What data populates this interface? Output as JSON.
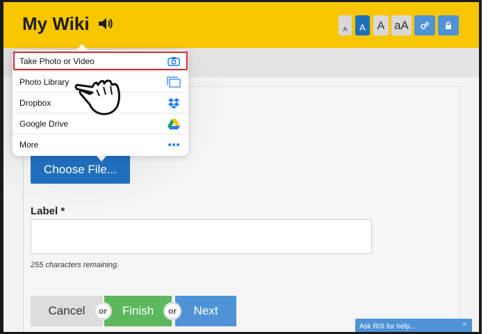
{
  "header": {
    "title": "My Wiki",
    "text_size_buttons": [
      "A",
      "A",
      "A",
      "aA"
    ],
    "speaker_icon": "speaker-icon",
    "settings_icon": "settings-icon",
    "lock_icon": "lock-icon",
    "accent_color": "#f8c600"
  },
  "popover": {
    "items": [
      {
        "label": "Take Photo or Video",
        "icon": "camera-icon"
      },
      {
        "label": "Photo Library",
        "icon": "photo-library-icon"
      },
      {
        "label": "Dropbox",
        "icon": "dropbox-icon"
      },
      {
        "label": "Google Drive",
        "icon": "google-drive-icon"
      },
      {
        "label": "More",
        "icon": "more-icon"
      }
    ]
  },
  "form": {
    "choose_file_label": "Choose File...",
    "label_field_label": "Label *",
    "label_value": "",
    "remaining_text": "255 characters remaining.",
    "cancel_label": "Cancel",
    "or_label": "or",
    "finish_label": "Finish",
    "next_label": "Next"
  },
  "help": {
    "label": "Ask RIX for help...",
    "chevron": "^"
  },
  "colors": {
    "primary_blue": "#1f6fbd",
    "light_blue": "#4f93d6",
    "green": "#5cb85c",
    "highlight_red": "#d8222a"
  }
}
